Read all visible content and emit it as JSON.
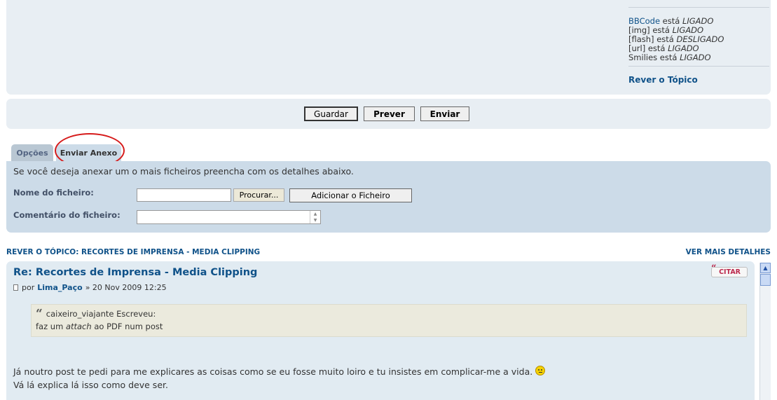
{
  "bbcode": {
    "bbcode_link": "BBCode",
    "bbcode_rest": " está ",
    "bbcode_state": "LIGADO",
    "img_text": "[img] está ",
    "img_state": "LIGADO",
    "flash_text": "[flash] está ",
    "flash_state": "DESLIGADO",
    "url_text": "[url] está ",
    "url_state": "LIGADO",
    "smilies_text": "Smilies está ",
    "smilies_state": "LIGADO",
    "review_topic": "Rever o Tópico"
  },
  "buttons": {
    "save": "Guardar",
    "preview": "Prever",
    "submit": "Enviar"
  },
  "tabs": [
    {
      "label": "Opções"
    },
    {
      "label": "Enviar Anexo"
    }
  ],
  "attachment": {
    "intro": "Se você deseja anexar um o mais ficheiros preencha com os detalhes abaixo.",
    "filename_label": "Nome do ficheiro:",
    "browse": "Procurar...",
    "add_file": "Adicionar o Ficheiro",
    "comment_label": "Comentário do ficheiro:"
  },
  "review": {
    "heading": "Rever o tópico: Recortes de Imprensa - Media Clipping",
    "more_details": "Ver mais detalhes"
  },
  "post": {
    "title": "Re: Recortes de Imprensa - Media Clipping",
    "by": "por",
    "author": "Lima_Paço",
    "date": "» 20 Nov 2009 12:25",
    "quote_button": "CITAR",
    "quote_author": "caixeiro_viajante Escreveu:",
    "quote_pre": "faz um ",
    "quote_em": "attach",
    "quote_post": " ao PDF num post",
    "body_line1": "Já noutro post te pedi para me explicares as coisas como se eu fosse muito loiro e tu insistes em complicar-me a vida.",
    "body_line2": "Vá lá explica lá isso como deve ser."
  }
}
